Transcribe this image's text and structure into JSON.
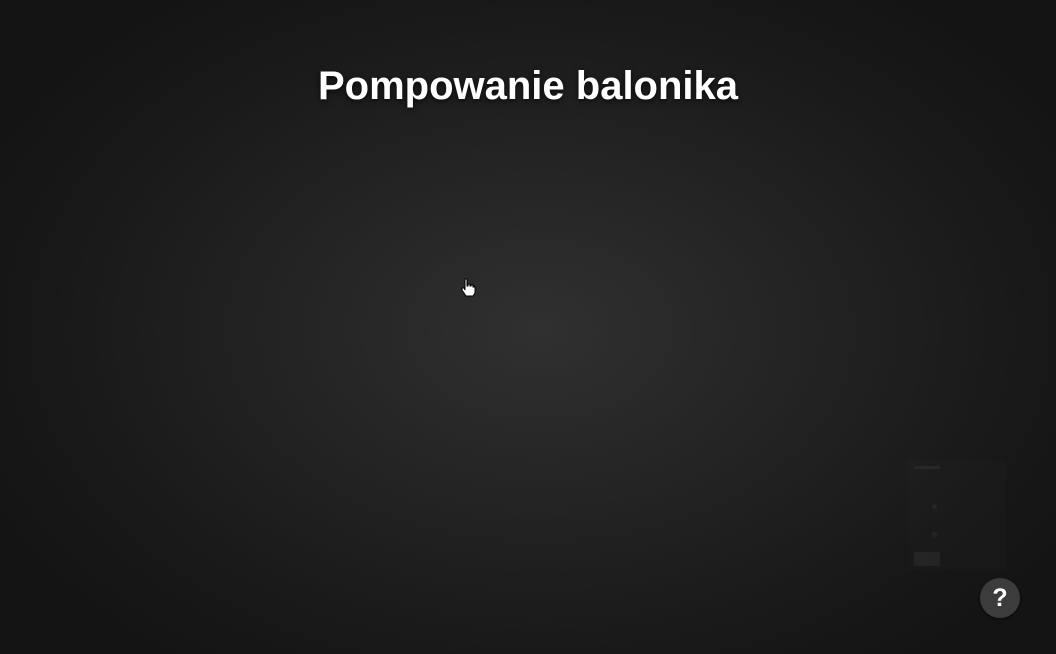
{
  "page": {
    "title": "Pompowanie balonika"
  },
  "help": {
    "label": "?",
    "icon": "question-mark-icon"
  },
  "cursor": {
    "icon": "hand-pointer-icon"
  },
  "theme": {
    "background": "#141414",
    "title_color": "#ffffff",
    "help_button_bg": "#3c3c3c"
  }
}
